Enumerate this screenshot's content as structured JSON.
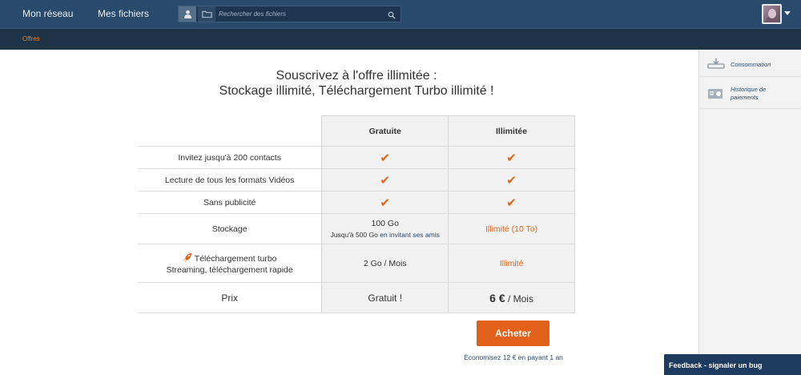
{
  "nav": {
    "my_network": "Mon réseau",
    "my_files": "Mes fichiers"
  },
  "search": {
    "placeholder": "Rechercher des fichiers"
  },
  "subnav": {
    "active_tab": "Offres"
  },
  "sidebar": {
    "items": [
      {
        "label": "Consommation",
        "icon": "storage-icon"
      },
      {
        "label": "Historique de paiements",
        "icon": "payment-history-icon"
      }
    ]
  },
  "main": {
    "title_line1": "Souscrivez à l'offre illimitée :",
    "title_line2": "Stockage illimité, Téléchargement Turbo illimité !",
    "columns": [
      "Gratuite",
      "Illimitée"
    ],
    "rows": {
      "contacts": "Invitez jusqu'à 200 contacts",
      "videos": "Lecture de tous les formats Vidéos",
      "no_ads": "Sans publicité",
      "storage": {
        "label": "Stockage",
        "free_main": "100 Go",
        "free_sub_prefix": "Jusqu'à 500 Go",
        "free_sub_link": "en invitant ses amis",
        "unlimited": "Illimité (10 To)"
      },
      "turbo": {
        "label_line1": "Téléchargement turbo",
        "label_line2": "Streaming, téléchargement rapide",
        "free": "2 Go / Mois",
        "unlimited": "Illimité"
      },
      "price": {
        "label": "Prix",
        "free": "Gratuit !",
        "unlimited_amount": "6 €",
        "unlimited_period": " / Mois"
      }
    },
    "buy_button": "Acheter",
    "save_text": "Économisez 12 € en payant 1 an"
  },
  "feedback": "Feedback - signaler un bug",
  "colors": {
    "topbar": "#2a4a6b",
    "accent": "#e2621c",
    "check": "#e0661c"
  }
}
